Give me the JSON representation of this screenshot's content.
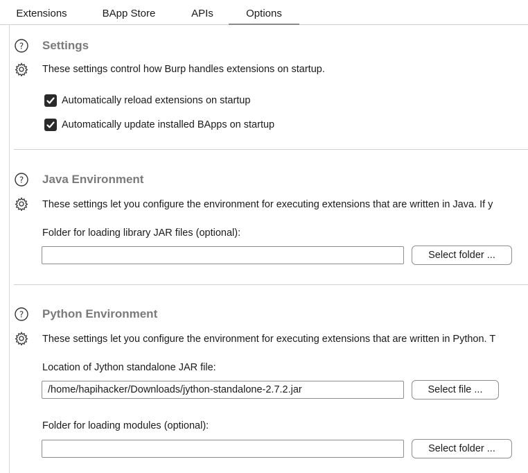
{
  "tabs": [
    {
      "label": "Extensions"
    },
    {
      "label": "BApp Store"
    },
    {
      "label": "APIs"
    },
    {
      "label": "Options",
      "active": true
    }
  ],
  "settings": {
    "title": "Settings",
    "description": "These settings control how Burp handles extensions on startup.",
    "checkboxes": [
      {
        "label": "Automatically reload extensions on startup",
        "checked": true
      },
      {
        "label": "Automatically update installed BApps on startup",
        "checked": true
      }
    ]
  },
  "java": {
    "title": "Java Environment",
    "description": "These settings let you configure the environment for executing extensions that are written in Java. If y",
    "folder_label": "Folder for loading library JAR files (optional):",
    "folder_value": "",
    "select_folder_button": "Select folder ..."
  },
  "python": {
    "title": "Python Environment",
    "description": "These settings let you configure the environment for executing extensions that are written in Python. T",
    "jython_label": "Location of Jython standalone JAR file:",
    "jython_value": "/home/hapihacker/Downloads/jython-standalone-2.7.2.jar",
    "select_file_button": "Select file ...",
    "modules_label": "Folder for loading modules (optional):",
    "modules_value": "",
    "select_folder_button": "Select folder ..."
  }
}
